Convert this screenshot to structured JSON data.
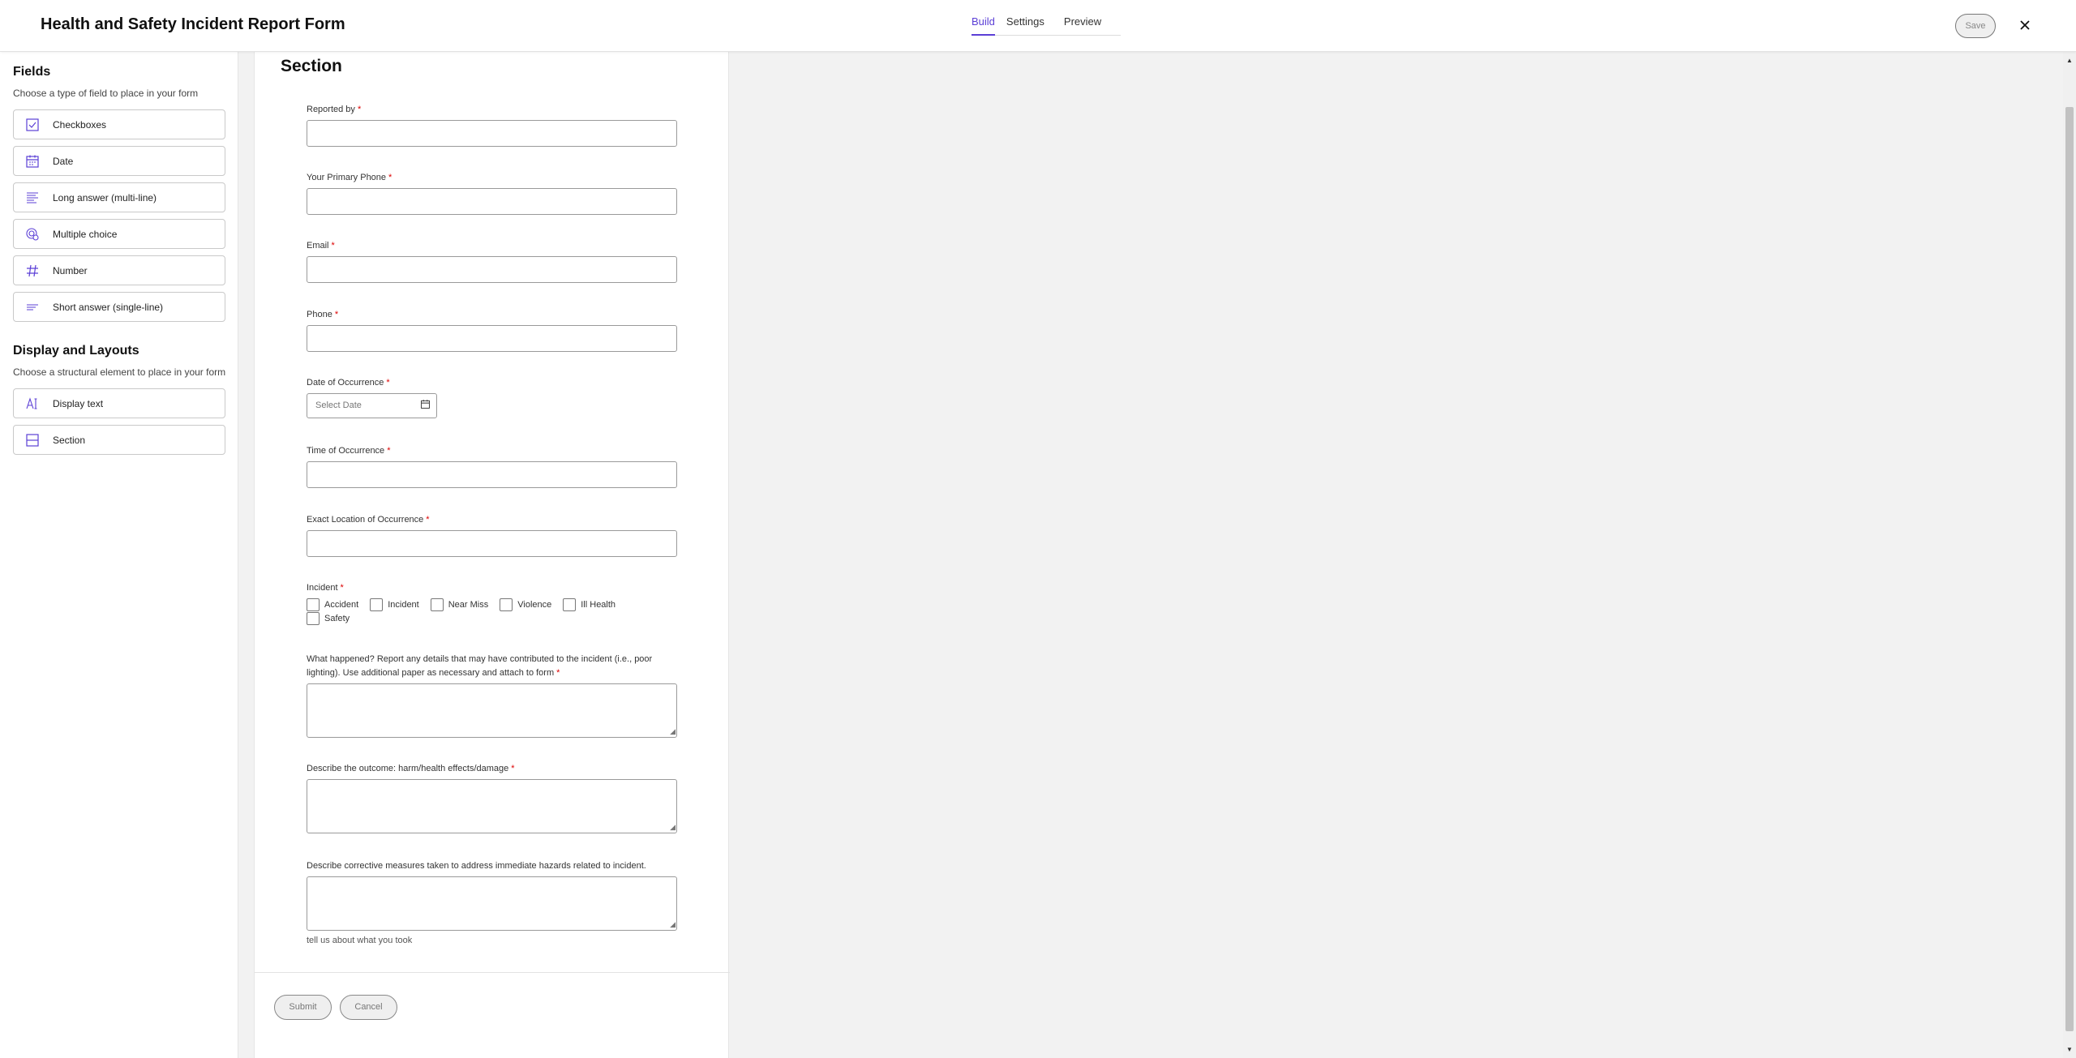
{
  "header": {
    "title": "Health and Safety Incident Report Form",
    "tabs": [
      {
        "label": "Build",
        "active": true
      },
      {
        "label": "Settings",
        "active": false
      },
      {
        "label": "Preview",
        "active": false
      }
    ],
    "save_label": "Save",
    "close_icon": "close-icon"
  },
  "sidebar": {
    "fields_heading": "Fields",
    "fields_sub": "Choose a type of field to place in your form",
    "fields": [
      {
        "label": "Checkboxes",
        "icon": "checkbox-icon"
      },
      {
        "label": "Date",
        "icon": "calendar-icon"
      },
      {
        "label": "Long answer (multi-line)",
        "icon": "multiline-text-icon"
      },
      {
        "label": "Multiple choice",
        "icon": "multiple-choice-icon"
      },
      {
        "label": "Number",
        "icon": "hash-icon"
      },
      {
        "label": "Short answer (single-line)",
        "icon": "short-text-icon"
      }
    ],
    "layouts_heading": "Display and Layouts",
    "layouts_sub": "Choose a structural element to place in your form",
    "layouts": [
      {
        "label": "Display text",
        "icon": "display-text-icon"
      },
      {
        "label": "Section",
        "icon": "section-icon"
      }
    ]
  },
  "form": {
    "section_title": "Section",
    "fields": {
      "reported_by": "Reported by",
      "primary_phone": "Your Primary Phone",
      "email": "Email",
      "phone": "Phone",
      "date_of_occurrence": "Date of Occurrence",
      "date_placeholder": "Select Date",
      "time_of_occurrence": "Time of Occurrence",
      "exact_location": "Exact Location of Occurrence",
      "incident": "Incident",
      "what_happened_line1": "What happened? Report any details that may have contributed to the incident (i.e., poor",
      "what_happened_line2": "lighting). Use additional paper as necessary and attach to form",
      "outcome": "Describe the outcome: harm/health effects/damage",
      "corrective": "Describe corrective measures taken to address immediate hazards related to incident.",
      "corrective_hint": "tell us about what you took"
    },
    "required_mark": "*",
    "incident_options": [
      "Accident",
      "Incident",
      "Near Miss",
      "Violence",
      "Ill Health",
      "Safety"
    ],
    "submit_label": "Submit",
    "cancel_label": "Cancel"
  }
}
